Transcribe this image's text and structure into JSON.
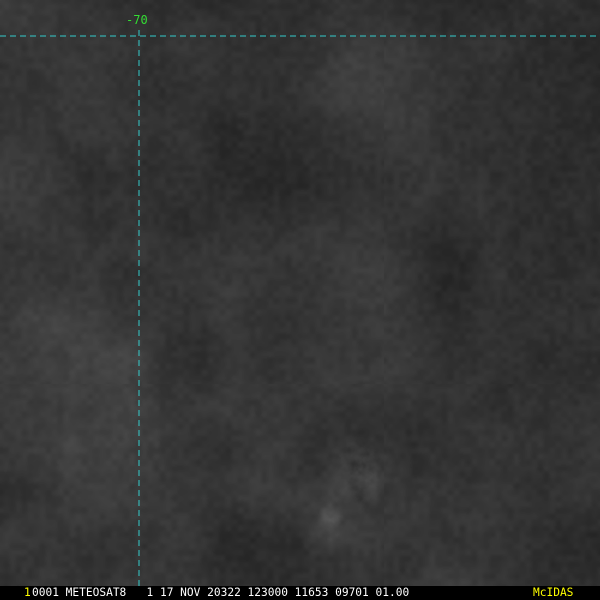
{
  "colors": {
    "grid_line": "#33cccc",
    "label_green": "#33dd33",
    "frame_number": "#ffff00",
    "status_text": "#ffffff",
    "brand_text": "#ffff00",
    "background": "#000000"
  },
  "overlay": {
    "longitude_label": "-70"
  },
  "status_bar": {
    "frame_number": "1",
    "text": "0001 METEOSAT8   1 17 NOV 20322 123000 11653 09701 01.00",
    "brand": "McIDAS"
  }
}
